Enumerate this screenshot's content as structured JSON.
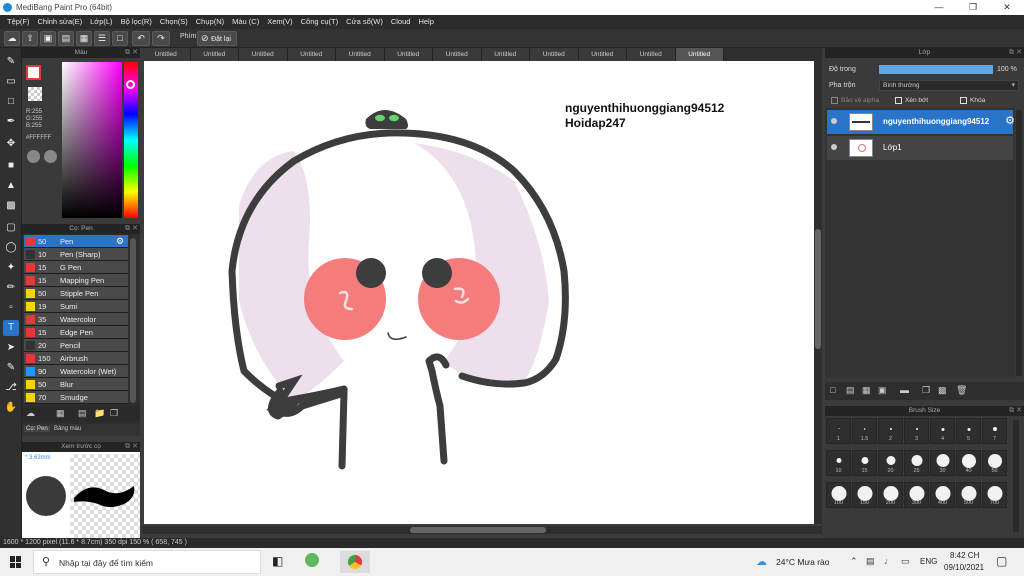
{
  "app": {
    "title": "MediBang Paint Pro (64bit)"
  },
  "menu": [
    "Tệp(F)",
    "Chỉnh sửa(E)",
    "Lớp(L)",
    "Bộ lọc(R)",
    "Chọn(S)",
    "Chụp(N)",
    "Màu (C)",
    "Xem(V)",
    "Công cụ(T)",
    "Cửa sổ(W)",
    "Cloud",
    "Help"
  ],
  "toolbar": {
    "hand_label": "Phím",
    "reset_label": "Đặt lại"
  },
  "panels": {
    "color": {
      "title": "Màu",
      "r": "R:255",
      "g": "G:255",
      "b": "B:255",
      "hex": "#FFFFFF"
    },
    "brush": {
      "title": "Cọ: Pen",
      "tab1": "Cọ: Pen",
      "tab2": "Bảng màu",
      "items": [
        {
          "size": "50",
          "name": "Pen",
          "color": "#2a74c8",
          "selected": true
        },
        {
          "size": "10",
          "name": "Pen (Sharp)",
          "color": "#333333"
        },
        {
          "size": "15",
          "name": "G Pen",
          "color": "#e53935"
        },
        {
          "size": "15",
          "name": "Mapping Pen",
          "color": "#e53935"
        },
        {
          "size": "50",
          "name": "Stipple Pen",
          "color": "#f5d400"
        },
        {
          "size": "19",
          "name": "Sumi",
          "color": "#f5d400"
        },
        {
          "size": "35",
          "name": "Watercolor",
          "color": "#e53935"
        },
        {
          "size": "15",
          "name": "Edge Pen",
          "color": "#e53935"
        },
        {
          "size": "20",
          "name": "Pencil",
          "color": "#333333"
        },
        {
          "size": "150",
          "name": "Airbrush",
          "color": "#e53935"
        },
        {
          "size": "90",
          "name": "Watercolor (Wet)",
          "color": "#2196f3"
        },
        {
          "size": "50",
          "name": "Blur",
          "color": "#f5d400"
        },
        {
          "size": "70",
          "name": "Smudge",
          "color": "#f5d400"
        }
      ]
    },
    "preview": {
      "title": "Xem trước cọ",
      "size": "* 3.63mm"
    },
    "layer": {
      "title": "Lớp",
      "opacity_label": "Độ trong",
      "opacity_value": "100 %",
      "opacity_fraction": 1.0,
      "blend_label": "Pha trộn",
      "blend_value": "Bình thường",
      "protect_alpha": "Bảo vệ alpha",
      "clip": "Xén bớt",
      "lock": "Khóa",
      "layers": [
        {
          "name": "nguyenthihuonggiang94512",
          "selected": true
        },
        {
          "name": "Lớp1",
          "selected": false
        }
      ]
    },
    "brushsize": {
      "title": "Brush Size",
      "sizes": [
        "1",
        "1.5",
        "2",
        "3",
        "4",
        "5",
        "7",
        "10",
        "15",
        "20",
        "25",
        "30",
        "40",
        "50",
        "100",
        "150",
        "200",
        "300",
        "400",
        "500",
        "700"
      ]
    }
  },
  "doc_tabs": [
    "Untitled",
    "Untitled",
    "Untitled",
    "Untitled",
    "Untitled",
    "Untitled",
    "Untitled",
    "Untitled",
    "Untitled",
    "Untitled",
    "Untitled",
    "Untitled"
  ],
  "canvas": {
    "text_line1": "nguyenthihuonggiang94512",
    "text_line2": "Hoidap247"
  },
  "status": {
    "text": "1600 * 1200 pixel    (11.6 * 8.7cm)    350 dpi    150 %    ( 658, 745 )"
  },
  "taskbar": {
    "search_placeholder": "Nhập tại đây để tìm kiếm",
    "weather": "24°C  Mưa rào",
    "lang": "ENG",
    "time": "8:42 CH",
    "date": "09/10/2021"
  }
}
